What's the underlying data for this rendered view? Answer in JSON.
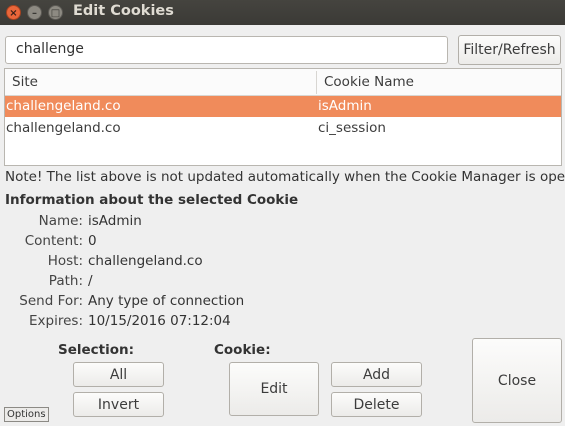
{
  "window": {
    "title": "Edit Cookies",
    "close_glyph": "×",
    "minimize_glyph": "–",
    "maximize_glyph": "□"
  },
  "search": {
    "value": "challenge",
    "filter_label": "Filter/Refresh"
  },
  "table": {
    "columns": [
      "Site",
      "Cookie Name"
    ],
    "rows": [
      {
        "site": "challengeland.co",
        "name": "isAdmin",
        "selected": true
      },
      {
        "site": "challengeland.co",
        "name": "ci_session",
        "selected": false
      }
    ]
  },
  "note": "Note! The list above is not updated automatically when the Cookie Manager is open.",
  "info": {
    "heading": "Information about the selected Cookie",
    "fields": [
      {
        "label": "Name:",
        "value": "isAdmin"
      },
      {
        "label": "Content:",
        "value": "0"
      },
      {
        "label": "Host:",
        "value": "challengeland.co"
      },
      {
        "label": "Path:",
        "value": "/"
      },
      {
        "label": "Send For:",
        "value": "Any type of connection"
      },
      {
        "label": "Expires:",
        "value": "10/15/2016 07:12:04"
      }
    ]
  },
  "selection": {
    "label": "Selection:",
    "all": "All",
    "invert": "Invert"
  },
  "cookie": {
    "label": "Cookie:",
    "edit": "Edit",
    "add": "Add",
    "delete": "Delete"
  },
  "close_label": "Close",
  "options_label": "Options",
  "colors": {
    "selection": "#f08b5b",
    "titlebar": "#3c3b37",
    "close_button": "#e9663a"
  }
}
